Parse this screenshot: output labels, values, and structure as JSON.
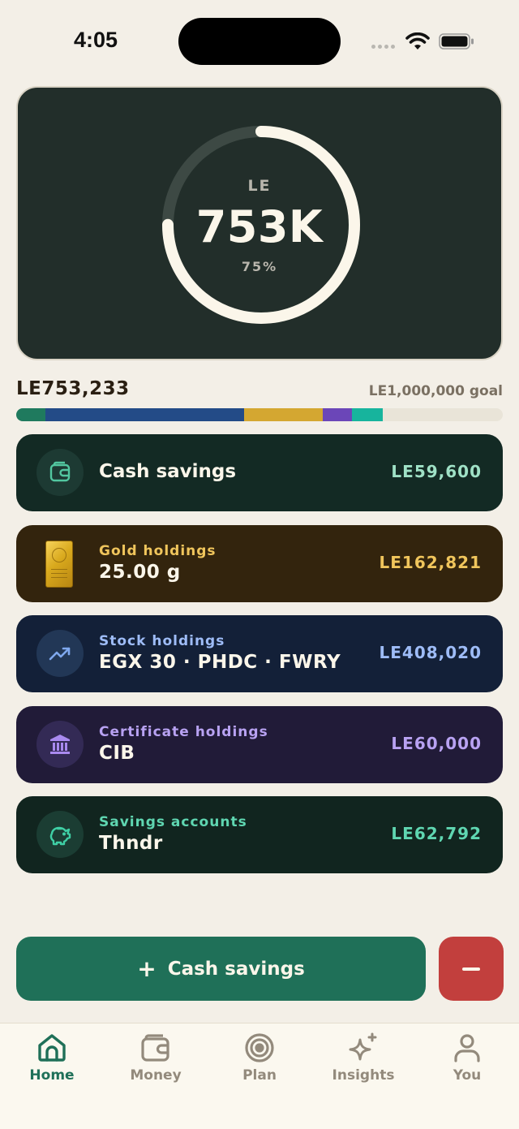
{
  "status_bar": {
    "time": "4:05"
  },
  "hero": {
    "currency": "LE",
    "amount": "753K",
    "percent": "75%",
    "progress": 0.75
  },
  "summary": {
    "total": "LE753,233",
    "goal": "LE1,000,000 goal"
  },
  "allocation": [
    {
      "name": "cash",
      "fraction": 0.0596,
      "color": "#1f7a5e"
    },
    {
      "name": "stocks",
      "fraction": 0.408,
      "color": "#234b87"
    },
    {
      "name": "gold",
      "fraction": 0.1628,
      "color": "#d4a731"
    },
    {
      "name": "certificates",
      "fraction": 0.06,
      "color": "#6b46b8"
    },
    {
      "name": "savings",
      "fraction": 0.0628,
      "color": "#17b49d"
    }
  ],
  "holdings": [
    {
      "id": "cash",
      "title": "Cash savings",
      "value": "LE59,600",
      "bg": "#132a24",
      "accent": "#9fe1c6",
      "icon": "wallet-icon"
    },
    {
      "id": "gold",
      "label": "Gold holdings",
      "main": "25.00 g",
      "value": "LE162,821",
      "bg": "#33240d",
      "accent": "#f0c55c",
      "icon": "gold-bar-icon"
    },
    {
      "id": "stock",
      "label": "Stock holdings",
      "main": "EGX 30 · PHDC · FWRY",
      "value": "LE408,020",
      "bg": "#132038",
      "accent": "#9ebcf7",
      "icon": "trend-up-icon"
    },
    {
      "id": "certificate",
      "label": "Certificate holdings",
      "main": "CIB",
      "value": "LE60,000",
      "bg": "#211b38",
      "accent": "#b8a2f2",
      "icon": "bank-icon"
    },
    {
      "id": "savings",
      "label": "Savings accounts",
      "main": "Thndr",
      "value": "LE62,792",
      "bg": "#11251f",
      "accent": "#5fd6b1",
      "icon": "piggy-bank-icon"
    }
  ],
  "actions": {
    "primary_label": "Cash savings",
    "primary_icon": "+"
  },
  "tabs": [
    {
      "label": "Home",
      "icon": "home-icon",
      "active": true
    },
    {
      "label": "Money",
      "icon": "wallet-icon"
    },
    {
      "label": "Plan",
      "icon": "target-icon"
    },
    {
      "label": "Insights",
      "icon": "sparkle-icon"
    },
    {
      "label": "You",
      "icon": "person-icon"
    }
  ]
}
